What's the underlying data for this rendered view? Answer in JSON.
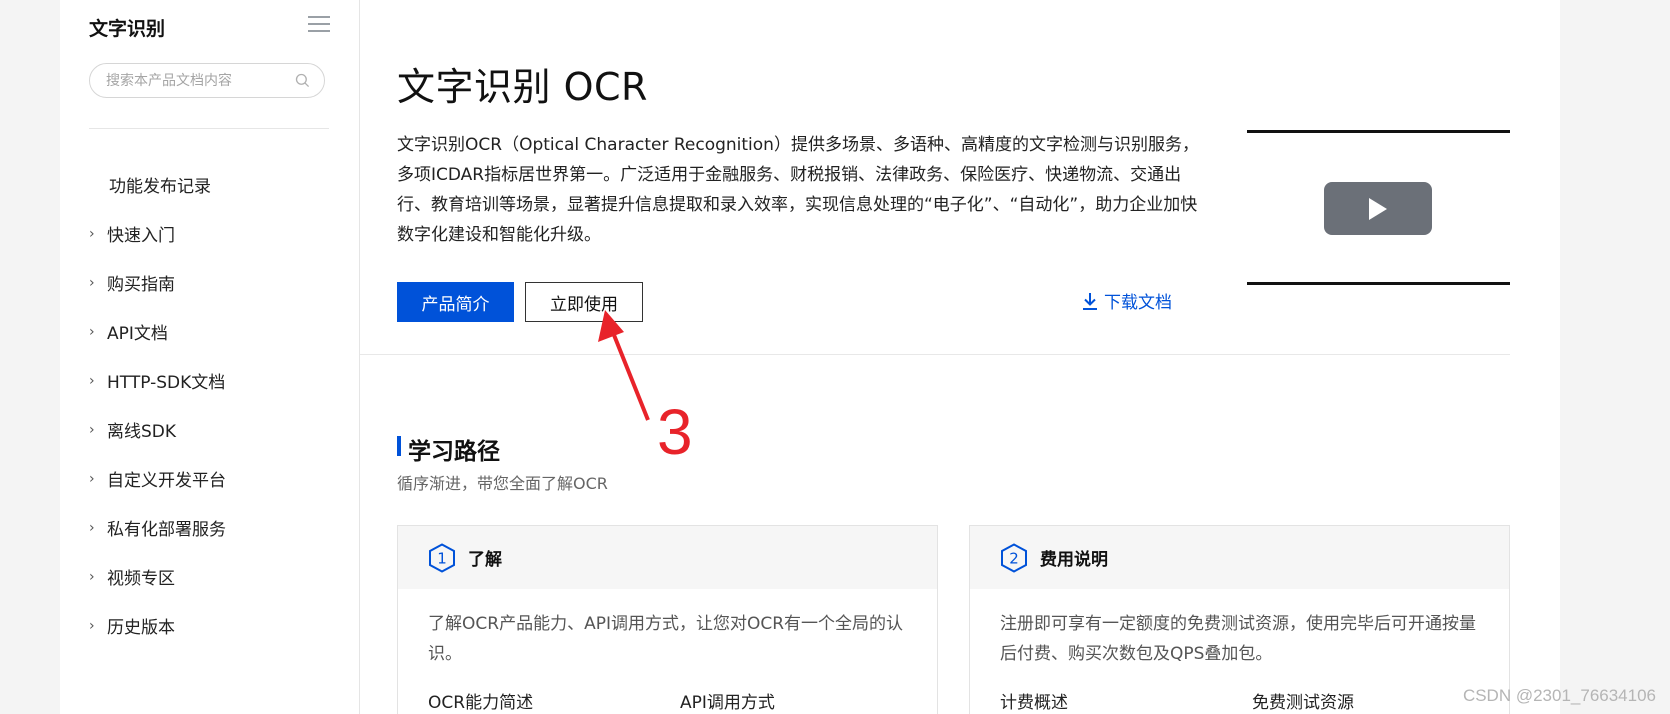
{
  "sidebar": {
    "title": "文字识别",
    "search_placeholder": "搜索本产品文档内容",
    "items": [
      {
        "label": "功能发布记录",
        "expandable": false
      },
      {
        "label": "快速入门",
        "expandable": true
      },
      {
        "label": "购买指南",
        "expandable": true
      },
      {
        "label": "API文档",
        "expandable": true
      },
      {
        "label": "HTTP-SDK文档",
        "expandable": true
      },
      {
        "label": "离线SDK",
        "expandable": true
      },
      {
        "label": "自定义开发平台",
        "expandable": true
      },
      {
        "label": "私有化部署服务",
        "expandable": true
      },
      {
        "label": "视频专区",
        "expandable": true
      },
      {
        "label": "历史版本",
        "expandable": true
      }
    ]
  },
  "hero": {
    "title": "文字识别 OCR",
    "description": "文字识别OCR（Optical Character Recognition）提供多场景、多语种、高精度的文字检测与识别服务，多项ICDAR指标居世界第一。广泛适用于金融服务、财税报销、法律政务、保险医疗、快递物流、交通出行、教育培训等场景，显著提升信息提取和录入效率，实现信息处理的“电子化”、“自动化”，助力企业加快数字化建设和智能化升级。",
    "primary_button": "产品简介",
    "secondary_button": "立即使用",
    "download_link": "下载文档"
  },
  "learning": {
    "title": "学习路径",
    "subtitle": "循序渐进，带您全面了解OCR",
    "cards": [
      {
        "number": "1",
        "title": "了解",
        "body": "了解OCR产品能力、API调用方式，让您对OCR有一个全局的认识。",
        "links": [
          "OCR能力简述",
          "API调用方式"
        ]
      },
      {
        "number": "2",
        "title": "费用说明",
        "body": "注册即可享有一定额度的免费测试资源，使用完毕后可开通按量后付费、购买次数包及QPS叠加包。",
        "links": [
          "计费概述",
          "免费测试资源"
        ]
      }
    ]
  },
  "annotation": {
    "number": "3",
    "color": "#e8232a"
  },
  "watermark": "CSDN @2301_76634106",
  "colors": {
    "accent": "#0052d9",
    "annotation": "#e8232a"
  }
}
